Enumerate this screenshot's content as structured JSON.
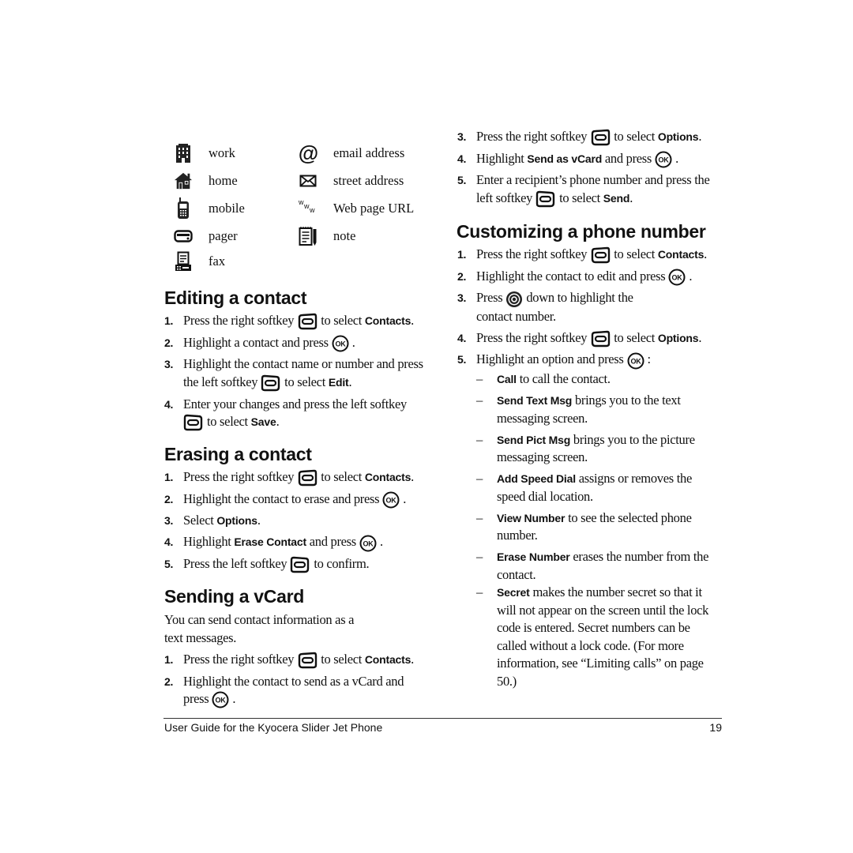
{
  "icon_legend": [
    {
      "icon": "work-building-icon",
      "label": "work"
    },
    {
      "icon": "email-at-icon",
      "label": "email address"
    },
    {
      "icon": "home-house-icon",
      "label": "home"
    },
    {
      "icon": "street-address-envelope-icon",
      "label": "street address"
    },
    {
      "icon": "mobile-phone-icon",
      "label": "mobile"
    },
    {
      "icon": "web-url-www-icon",
      "label": "Web page URL"
    },
    {
      "icon": "pager-icon",
      "label": "pager"
    },
    {
      "icon": "note-notepad-icon",
      "label": "note"
    },
    {
      "icon": "fax-icon",
      "label": "fax"
    }
  ],
  "editing": {
    "title": "Editing a contact",
    "steps": [
      {
        "num": "1.",
        "a": "Press the right softkey",
        "key": "right-softkey",
        "b": "to select",
        "bold": "Contacts",
        "c": "."
      },
      {
        "num": "2.",
        "a": "Highlight a contact and press",
        "key": "ok",
        "c": "."
      },
      {
        "num": "3.",
        "a": "Highlight the contact name or number and press the left softkey",
        "key": "left-softkey",
        "b": "to select",
        "bold": "Edit",
        "c": "."
      },
      {
        "num": "4.",
        "a": "Enter your changes and press the left softkey",
        "key": "left-softkey",
        "b": "to select",
        "bold": "Save",
        "c": "."
      }
    ]
  },
  "erasing": {
    "title": "Erasing a contact",
    "steps": [
      {
        "num": "1.",
        "a": "Press the right softkey",
        "b": "to select",
        "bold": "Contacts",
        "c": "."
      },
      {
        "num": "2.",
        "a": "Highlight the contact to erase and press",
        "c": "."
      },
      {
        "num": "3.",
        "a": "Select",
        "bold": "Options",
        "c": "."
      },
      {
        "num": "4.",
        "a": "Highlight",
        "bold": "Erase Contact",
        "b": "and press",
        "c": "."
      },
      {
        "num": "5.",
        "a": "Press the left softkey",
        "b": "to confirm."
      }
    ]
  },
  "vcard": {
    "title": "Sending a vCard",
    "intro": "You can send contact information as a text messages.",
    "steps": [
      {
        "num": "1.",
        "a": "Press the right softkey",
        "b": "to select",
        "bold": "Contacts",
        "c": "."
      },
      {
        "num": "2.",
        "a": "Highlight the contact to send as a vCard and press",
        "c": "."
      },
      {
        "num": "3.",
        "a": "Press the right softkey",
        "b": "to select",
        "bold": "Options",
        "c": "."
      },
      {
        "num": "4.",
        "a": "Highlight",
        "bold": "Send as vCard",
        "b": "and press",
        "c": "."
      },
      {
        "num": "5.",
        "a": "Enter a recipient’s phone number and press the left softkey",
        "b": "to select",
        "bold": "Send",
        "c": "."
      }
    ]
  },
  "customizing": {
    "title": "Customizing a phone number",
    "steps": [
      {
        "num": "1.",
        "a": "Press the right softkey",
        "b": "to select",
        "bold": "Contacts",
        "c": "."
      },
      {
        "num": "2.",
        "a": "Highlight the contact to edit and press",
        "c": "."
      },
      {
        "num": "3.",
        "a": "Press",
        "b": "down to highlight the contact number."
      },
      {
        "num": "4.",
        "a": "Press the right softkey",
        "b": "to select",
        "bold": "Options",
        "c": "."
      },
      {
        "num": "5.",
        "a": "Highlight an option and press",
        "c": ":"
      }
    ],
    "options": [
      {
        "bold": "Call",
        "text": "to call the contact."
      },
      {
        "bold": "Send Text Msg",
        "text": "brings you to the text messaging screen."
      },
      {
        "bold": "Send Pict Msg",
        "text": "brings you to the picture messaging screen."
      },
      {
        "bold": "Add Speed Dial",
        "text": "assigns or removes the speed dial location."
      },
      {
        "bold": "View Number",
        "text": "to see the selected phone number."
      },
      {
        "bold": "Erase Number",
        "text": "erases the number from the contact."
      },
      {
        "bold": "Secret",
        "text": "makes the number secret so that it will not appear on the screen until the lock code is entered. Secret numbers can be called without a lock code. (For more information, see “Limiting calls” on page 50.)"
      }
    ]
  },
  "footer": {
    "title": "User Guide for the Kyocera Slider Jet Phone",
    "page": "19"
  }
}
